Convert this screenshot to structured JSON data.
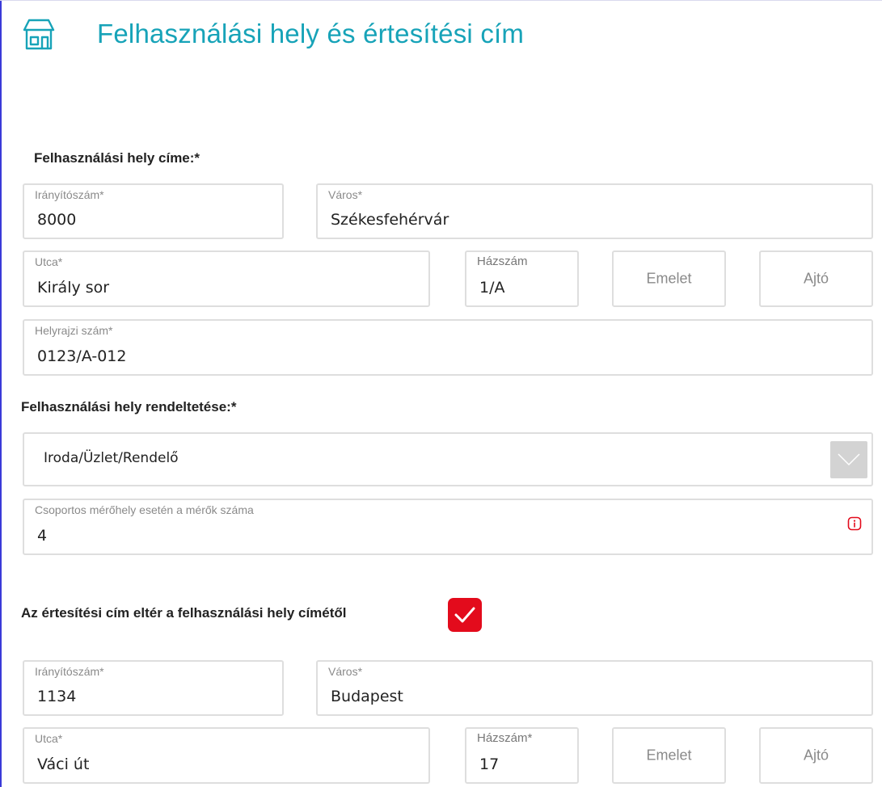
{
  "header": {
    "title": "Felhasználási hely és értesítési cím",
    "icon": "house-icon",
    "accent_color": "#17a3b8"
  },
  "consumption_place": {
    "section_label": "Felhasználási hely címe:*",
    "postal_code": {
      "label": "Irányítószám*",
      "value": "8000"
    },
    "city": {
      "label": "Város*",
      "value": "Székesfehérvár"
    },
    "street": {
      "label": "Utca*",
      "value": "Király sor"
    },
    "house_number": {
      "label": "Házszám",
      "value": "1/A"
    },
    "floor": {
      "placeholder": "Emelet"
    },
    "door": {
      "placeholder": "Ajtó"
    },
    "lot_number": {
      "label": "Helyrajzi szám*",
      "value": "0123/A-012"
    }
  },
  "purpose": {
    "section_label": "Felhasználási hely rendeltetése:*",
    "selected": "Iroda/Üzlet/Rendelő",
    "meter_count": {
      "label": "Csoportos mérőhely esetén a mérők száma",
      "value": "4"
    }
  },
  "notification": {
    "checkbox_label": "Az értesítési cím eltér a felhasználási hely címétől",
    "checked": true,
    "checkbox_color": "#e30b1c",
    "postal_code": {
      "label": "Irányítószám*",
      "value": "1134"
    },
    "city": {
      "label": "Város*",
      "value": "Budapest"
    },
    "street": {
      "label": "Utca*",
      "value": "Váci út"
    },
    "house_number": {
      "label": "Házszám*",
      "value": "17"
    },
    "floor": {
      "placeholder": "Emelet"
    },
    "door": {
      "placeholder": "Ajtó"
    }
  }
}
